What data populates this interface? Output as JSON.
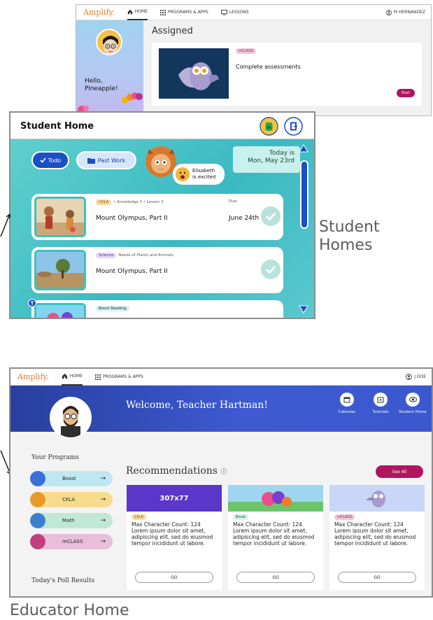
{
  "student_app": {
    "brand": "Amplify.",
    "nav": {
      "home": "HOME",
      "programs": "PROGRAMS & APPS",
      "lessons": "LESSONS",
      "user": "M HERNANDEZ"
    },
    "greeting_line1": "Hello,",
    "greeting_line2": "Pineapple!",
    "section": "Assigned",
    "card": {
      "chip": "mCLASS",
      "title": "Complete assessments",
      "button": "Start"
    }
  },
  "student_home": {
    "title": "Student Home",
    "todo": "Todo",
    "past_work": "Past Work",
    "mood_name": "Elisabeth",
    "mood_text": "is excited",
    "today_line1": "Today is",
    "today_line2": "Mon, May 23rd",
    "tasks": [
      {
        "chip": "CKLA",
        "meta": "• Knowledge 3 • Lesson 3",
        "title": "Mount Olympus, Part II",
        "due_label": "Due:",
        "due": "June 24th"
      },
      {
        "chip": "Science",
        "meta": "Needs of Plants and Animals",
        "title": "Mount Olympus, Part II"
      },
      {
        "chip": "Boost Reading"
      }
    ]
  },
  "callouts": {
    "student_line1": "Student",
    "student_line2": "Homes",
    "educator": "Educator Home"
  },
  "educator": {
    "brand": "Amplify.",
    "nav": {
      "home": "HOME",
      "programs": "PROGRAMS & APPS",
      "user": "J DOE"
    },
    "welcome": "Welcome, Teacher Hartman!",
    "banner_buttons": {
      "calendar": "Calendar",
      "tutorials": "Tutorials",
      "student_home": "Student Home"
    },
    "your_programs": "Your Programs",
    "programs": [
      "Boost",
      "CKLA",
      "Math",
      "mCLASS"
    ],
    "poll": "Today's Poll Results",
    "recommendations": "Recommendations",
    "see_all": "See All",
    "rec_cards": [
      {
        "image_label": "307x77",
        "chip": "CKLA",
        "text": "Max Character Count: 124 Lorem ipsum dolor sit amet, adipiscing elit, sed do eiusmod tempor incididunt ut labore.",
        "button": "GO"
      },
      {
        "chip": "Boost",
        "text": "Max Character Count: 124 Lorem ipsum dolor sit amet, adipiscing elit, sed do eiusmod tempor incididunt ut labore.",
        "button": "GO"
      },
      {
        "chip": "mCLASS",
        "text": "Max Character Count: 124 Lorem ipsum dolor sit amet, adipiscing elit, sed do eiusmod tempor incididunt ut labore.",
        "button": "GO"
      }
    ]
  },
  "colors": {
    "teal": "#3bb9c2",
    "blue": "#1b4fc4",
    "magenta": "#b0155e",
    "banner": "#3d5ad0",
    "brand_orange": "#e07a2c"
  }
}
